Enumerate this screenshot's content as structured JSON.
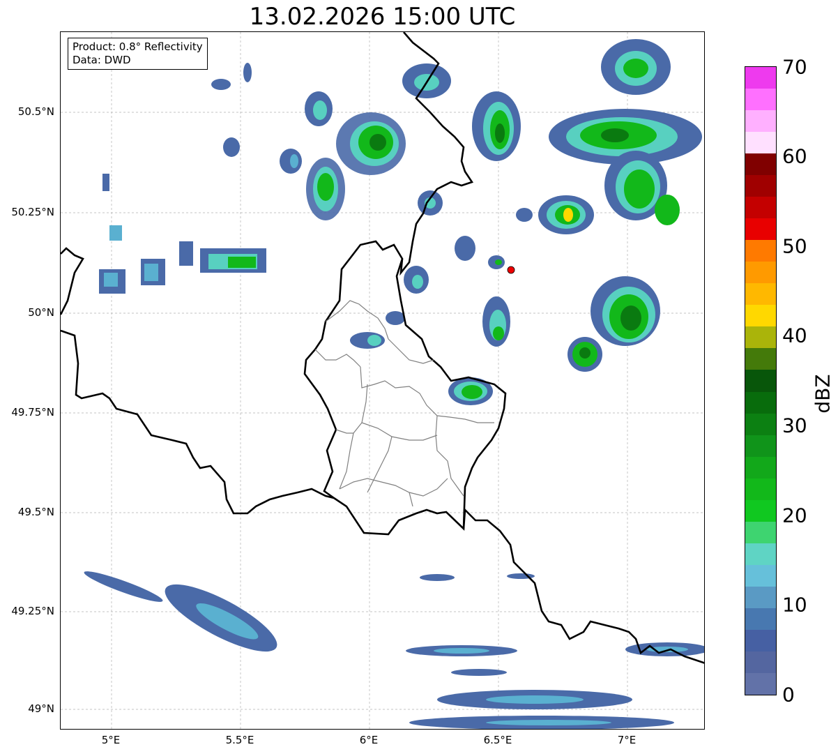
{
  "title": "13.02.2026 15:00 UTC",
  "info": {
    "product_line": "Product: 0.8° Reflectivity",
    "data_line": "Data: DWD"
  },
  "axes": {
    "lon_ticks": [
      "5°E",
      "5.5°E",
      "6°E",
      "6.5°E",
      "7°E"
    ],
    "lat_ticks": [
      "50.5°N",
      "50.25°N",
      "50°N",
      "49.75°N",
      "49.5°N",
      "49.25°N",
      "49°N"
    ]
  },
  "colorbar": {
    "label": "dBZ",
    "ticks": [
      "0",
      "10",
      "20",
      "30",
      "40",
      "50",
      "60",
      "70"
    ],
    "colors": [
      "#6272a8",
      "#5466a0",
      "#4660a3",
      "#4878b0",
      "#5a9ac4",
      "#66c0da",
      "#5fd4c4",
      "#3ed470",
      "#10c820",
      "#12b81a",
      "#12a81a",
      "#10941a",
      "#0c8012",
      "#086c0c",
      "#08560a",
      "#447a0a",
      "#aab40a",
      "#ffd800",
      "#ffb800",
      "#ff9a00",
      "#ff7a00",
      "#e80000",
      "#c40000",
      "#a00000",
      "#800000",
      "#ffe0ff",
      "#ffb0ff",
      "#ff70ff",
      "#ee3aee"
    ]
  },
  "map_palette": {
    "weak": "#4a6aa8",
    "light": "#5ab0d0",
    "cyan": "#58d0c0",
    "green": "#12b81a",
    "dark_green": "#0a7a10",
    "yellow": "#ffd800",
    "radar_site": "#ee0000"
  }
}
